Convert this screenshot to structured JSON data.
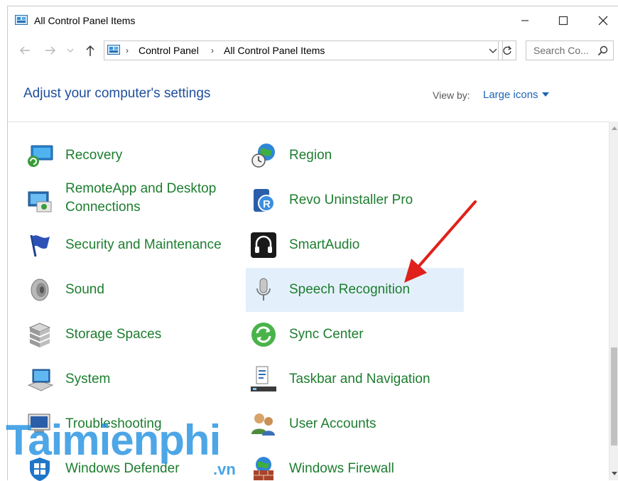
{
  "window": {
    "title": "All Control Panel Items"
  },
  "address": {
    "crumbs": [
      "Control Panel",
      "All Control Panel Items"
    ],
    "search_placeholder": "Search Co..."
  },
  "header": {
    "heading": "Adjust your computer's settings",
    "view_by_label": "View by:",
    "view_by_value": "Large icons"
  },
  "items_left": [
    {
      "label": "Recovery",
      "icon": "recovery-icon"
    },
    {
      "label": "RemoteApp and Desktop Connections",
      "line1": "RemoteApp and Desktop",
      "line2": "Connections",
      "icon": "remoteapp-icon"
    },
    {
      "label": "Security and Maintenance",
      "icon": "flag-icon"
    },
    {
      "label": "Sound",
      "icon": "speaker-icon"
    },
    {
      "label": "Storage Spaces",
      "icon": "storage-icon"
    },
    {
      "label": "System",
      "icon": "system-icon"
    },
    {
      "label": "Troubleshooting",
      "icon": "troubleshooting-icon"
    },
    {
      "label": "Windows Defender",
      "icon": "defender-icon"
    }
  ],
  "items_right": [
    {
      "label": "Region",
      "icon": "globe-clock-icon"
    },
    {
      "label": "Revo Uninstaller Pro",
      "icon": "revo-icon"
    },
    {
      "label": "SmartAudio",
      "icon": "headphones-icon"
    },
    {
      "label": "Speech Recognition",
      "icon": "microphone-icon",
      "highlighted": true
    },
    {
      "label": "Sync Center",
      "icon": "sync-icon"
    },
    {
      "label": "Taskbar and Navigation",
      "icon": "taskbar-icon"
    },
    {
      "label": "User Accounts",
      "icon": "users-icon"
    },
    {
      "label": "Windows Firewall",
      "icon": "firewall-icon"
    }
  ],
  "watermark": {
    "main": "Taimienphi",
    "suffix": ".vn"
  },
  "colors": {
    "link_green": "#1d7d2f",
    "heading_blue": "#1e4e9c",
    "highlight": "#e3f0fb",
    "arrow_red": "#e0201b"
  }
}
